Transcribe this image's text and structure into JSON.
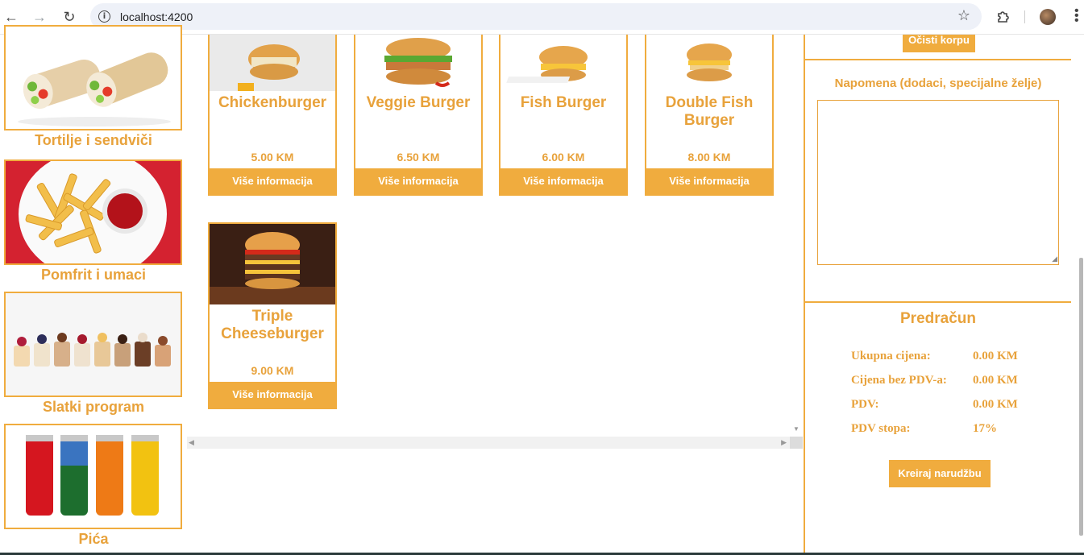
{
  "browser": {
    "url": "localhost:4200"
  },
  "categories": [
    {
      "label": "Tortilje i sendviči"
    },
    {
      "label": "Pomfrit i umaci"
    },
    {
      "label": "Slatki program"
    },
    {
      "label": "Pića"
    }
  ],
  "products": [
    {
      "name": "Chickenburger",
      "price": "5.00 KM",
      "button": "Više informacija"
    },
    {
      "name": "Veggie Burger",
      "price": "6.50 KM",
      "button": "Više informacija"
    },
    {
      "name": "Fish Burger",
      "price": "6.00 KM",
      "button": "Više informacija"
    },
    {
      "name": "Double Fish Burger",
      "price": "8.00 KM",
      "button": "Više informacija"
    },
    {
      "name": "Triple Cheeseburger",
      "price": "9.00 KM",
      "button": "Više informacija"
    }
  ],
  "cart": {
    "clear_label": "Očisti korpu"
  },
  "note": {
    "title": "Napomena (dodaci, specijalne želje)",
    "value": ""
  },
  "bill": {
    "title": "Predračun",
    "rows": [
      {
        "label": "Ukupna cijena:",
        "value": "0.00 KM"
      },
      {
        "label": "Cijena bez PDV-a:",
        "value": "0.00 KM"
      },
      {
        "label": "PDV:",
        "value": "0.00 KM"
      },
      {
        "label": "PDV stopa:",
        "value": "17%"
      }
    ],
    "create_label": "Kreiraj narudžbu"
  },
  "colors": {
    "accent": "#f0ac3e",
    "text_accent": "#e8a23b"
  }
}
